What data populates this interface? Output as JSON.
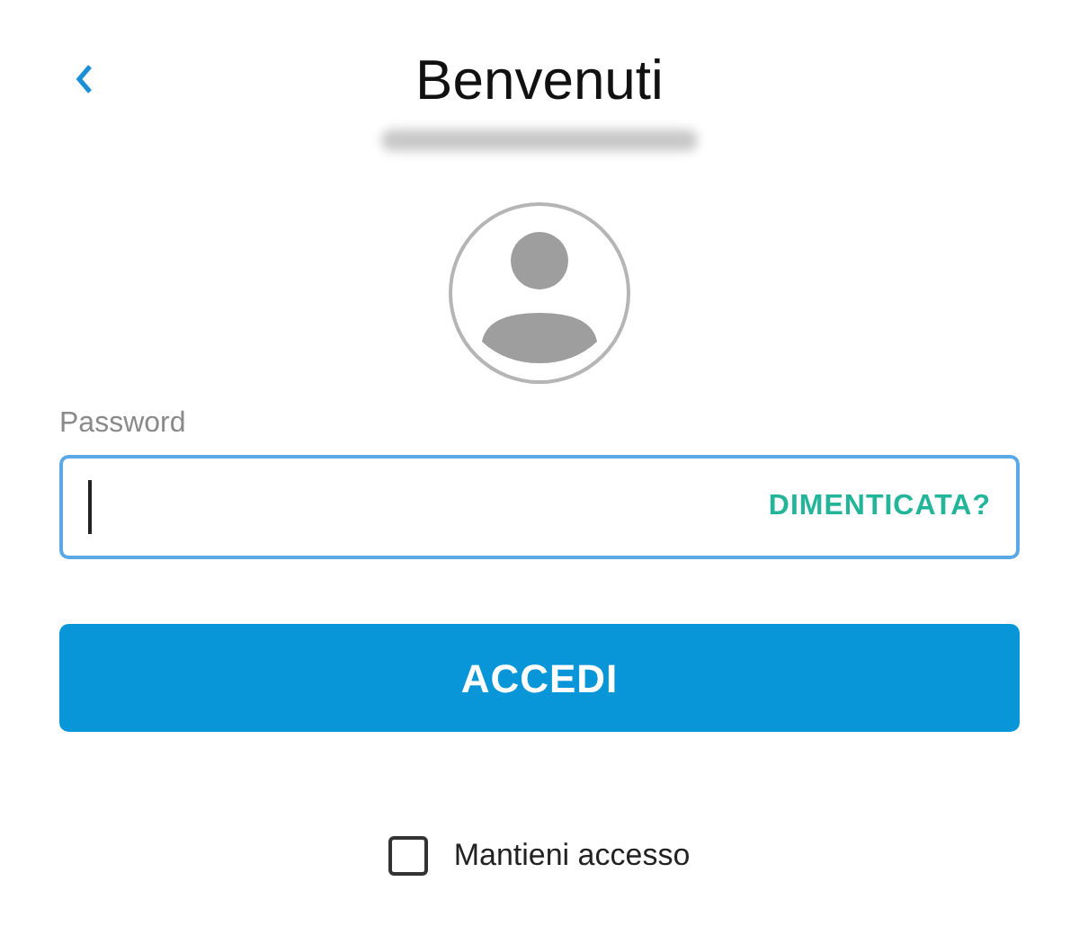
{
  "header": {
    "title": "Benvenuti"
  },
  "password": {
    "label": "Password",
    "focused": true,
    "forgot_link": "DIMENTICATA?"
  },
  "login_button": {
    "label": "ACCEDI"
  },
  "remember": {
    "label": "Mantieni accesso",
    "checked": false
  }
}
